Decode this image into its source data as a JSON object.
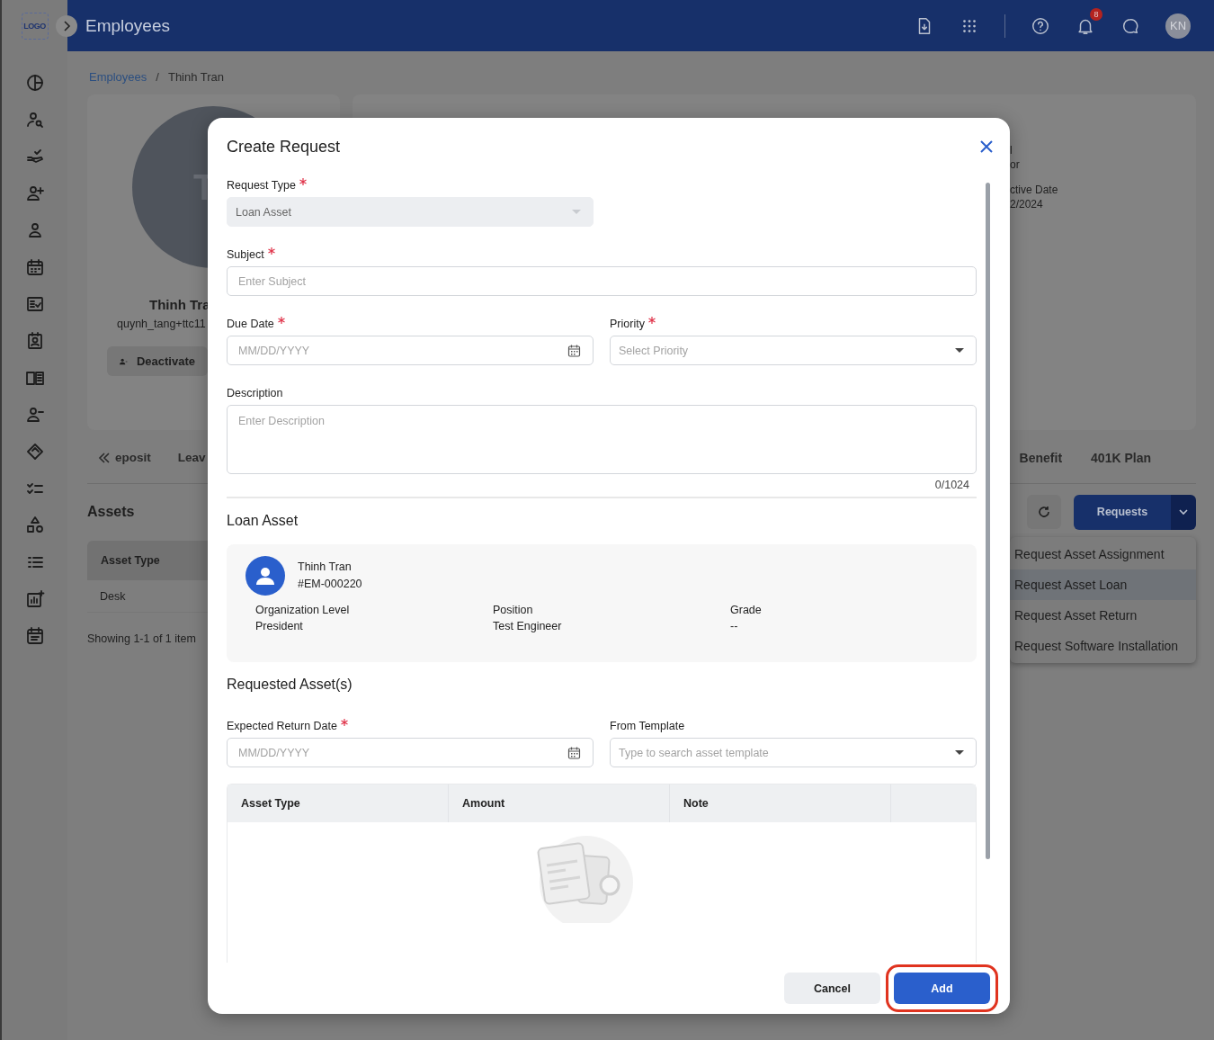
{
  "header": {
    "logo_text": "LOGO",
    "title": "Employees",
    "notification_count": "8",
    "avatar_initials": "KN"
  },
  "breadcrumb": {
    "items": [
      "Employees",
      "Thinh Tran"
    ],
    "separator": "/"
  },
  "profile": {
    "avatar_letter": "T",
    "name": "Thinh Tra",
    "email": "quynh_tang+ttc11",
    "action": "Deactivate"
  },
  "position_card": {
    "fragments": [
      "l",
      "or",
      "ctive Date",
      "2/2024"
    ]
  },
  "tabs": [
    {
      "label": "eposit"
    },
    {
      "label": "Leav"
    },
    {
      "label": "Benefit"
    },
    {
      "label": "401K Plan"
    }
  ],
  "assets": {
    "title": "Assets",
    "columns": [
      "Asset Type"
    ],
    "rows": [
      [
        "Desk"
      ]
    ],
    "footer": "Showing 1-1 of 1 item"
  },
  "requests_button": "Requests",
  "requests_menu": [
    {
      "label": "Request Asset Assignment",
      "selected": false
    },
    {
      "label": "Request Asset Loan",
      "selected": true
    },
    {
      "label": "Request Asset Return",
      "selected": false
    },
    {
      "label": "Request Software Installation",
      "selected": false
    }
  ],
  "modal": {
    "title": "Create Request",
    "fields": [
      {
        "kind": "select",
        "label": "Request Type",
        "required": true,
        "disabled": true,
        "value": "Loan Asset"
      },
      {
        "kind": "text",
        "label": "Subject",
        "required": true,
        "disabled": false,
        "placeholder": "Enter Subject"
      },
      {
        "kind": "date",
        "label": "Due Date",
        "required": true,
        "disabled": false,
        "placeholder": "MM/DD/YYYY"
      },
      {
        "kind": "select",
        "label": "Priority",
        "required": true,
        "disabled": false,
        "placeholder": "Select Priority"
      },
      {
        "kind": "textarea",
        "label": "Description",
        "required": false,
        "disabled": false,
        "placeholder": "Enter Description",
        "counter": "0/1024"
      }
    ],
    "loan_asset": {
      "title": "Loan Asset",
      "employee_name": "Thinh Tran",
      "employee_id": "#EM-000220",
      "details": [
        {
          "label": "Organization Level",
          "value": "President"
        },
        {
          "label": "Position",
          "value": "Test Engineer"
        },
        {
          "label": "Grade",
          "value": "--"
        }
      ]
    },
    "requested": {
      "title": "Requested Asset(s)",
      "fields": [
        {
          "kind": "date",
          "label": "Expected Return Date",
          "required": true,
          "disabled": false,
          "placeholder": "MM/DD/YYYY"
        },
        {
          "kind": "select",
          "label": "From Template",
          "required": false,
          "disabled": false,
          "placeholder": "Type to search asset template"
        }
      ],
      "columns": [
        "Asset Type",
        "Amount",
        "Note"
      ]
    },
    "buttons": [
      {
        "label": "Cancel",
        "kind": "secondary"
      },
      {
        "label": "Add",
        "kind": "primary"
      }
    ]
  }
}
